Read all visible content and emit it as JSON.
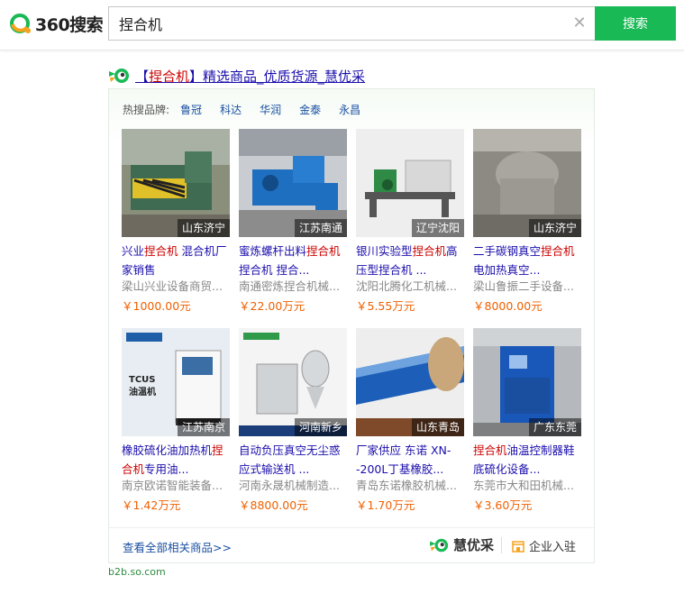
{
  "logo_text": "360搜索",
  "search": {
    "value": "捏合机",
    "button_label": "搜索"
  },
  "ad": {
    "title_prefix": "【",
    "title_keyword": "捏合机",
    "title_rest": "】精选商品_优质货源_慧优采",
    "hot_label": "热搜品牌:",
    "brands": [
      "鲁冠",
      "科达",
      "华润",
      "金泰",
      "永昌"
    ],
    "products": [
      {
        "name_a": "兴业",
        "name_hl": "捏合机",
        "name_b": " 混合机厂家销售",
        "shop": "梁山兴业设备商贸...",
        "price": "￥1000.00元",
        "location": "山东济宁"
      },
      {
        "name_a": "蜜炼螺杆出料",
        "name_hl": "捏合机",
        "name_b": "捏合机 捏合...",
        "shop": "南通密炼捏合机械...",
        "price": "￥22.00万元",
        "location": "江苏南通"
      },
      {
        "name_a": "银川实验型",
        "name_hl": "捏合机",
        "name_b": "高压型捏合机 ...",
        "shop": "沈阳北腾化工机械...",
        "price": "￥5.55万元",
        "location": "辽宁沈阳"
      },
      {
        "name_a": "二手碳钢真空",
        "name_hl": "捏合机",
        "name_b": "电加热真空...",
        "shop": "梁山鲁振二手设备...",
        "price": "￥8000.00元",
        "location": "山东济宁"
      },
      {
        "name_a": "橡胶硫化油加热机",
        "name_hl": "捏合机",
        "name_b": "专用油...",
        "shop": "南京欧诺智能装备...",
        "price": "￥1.42万元",
        "location": "江苏南京"
      },
      {
        "name_a": "自动负压真空无尘惑应式输送机 ...",
        "name_hl": "",
        "name_b": "",
        "shop": "河南永晟机械制造...",
        "price": "￥8800.00元",
        "location": "河南新乡"
      },
      {
        "name_a": "厂家供应 东诺 XN--200L丁基橡胶...",
        "name_hl": "",
        "name_b": "",
        "shop": "青岛东诺橡胶机械...",
        "price": "￥1.70万元",
        "location": "山东青岛"
      },
      {
        "name_a": "",
        "name_hl": "捏合机",
        "name_b": "油温控制器鞋底硫化设备...",
        "shop": "东莞市大和田机械...",
        "price": "￥3.60万元",
        "location": "广东东莞"
      }
    ],
    "view_all": "查看全部相关商品>>",
    "brand_name": "慧优采",
    "join_label": "企业入驻",
    "source_url": "b2b.so.com"
  },
  "colors": {
    "brand_green": "#19b955",
    "link_blue": "#1a0dab",
    "keyword_red": "#cc0000",
    "price_orange": "#f06000"
  }
}
